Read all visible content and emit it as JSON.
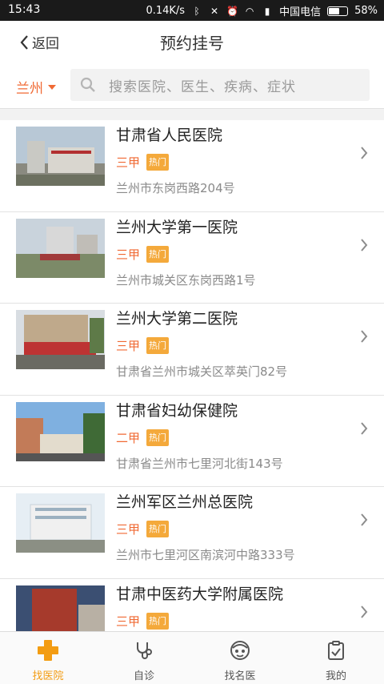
{
  "status": {
    "time": "15:43",
    "speed": "0.14K/s",
    "carrier": "中国电信",
    "battery": "58%",
    "battery_level": 0.58
  },
  "nav": {
    "back_label": "返回",
    "title": "预约挂号"
  },
  "search": {
    "city": "兰州",
    "placeholder": "搜索医院、医生、疾病、症状"
  },
  "hospitals": [
    {
      "name": "甘肃省人民医院",
      "level": "三甲",
      "badge": "热门",
      "address": "兰州市东岗西路204号"
    },
    {
      "name": "兰州大学第一医院",
      "level": "三甲",
      "badge": "热门",
      "address": "兰州市城关区东岗西路1号"
    },
    {
      "name": "兰州大学第二医院",
      "level": "三甲",
      "badge": "热门",
      "address": "甘肃省兰州市城关区萃英门82号"
    },
    {
      "name": "甘肃省妇幼保健院",
      "level": "二甲",
      "badge": "热门",
      "address": "甘肃省兰州市七里河北街143号"
    },
    {
      "name": "兰州军区兰州总医院",
      "level": "三甲",
      "badge": "热门",
      "address": "兰州市七里河区南滨河中路333号"
    },
    {
      "name": "甘肃中医药大学附属医院",
      "level": "三甲",
      "badge": "热门",
      "address": ""
    }
  ],
  "tabs": [
    {
      "label": "找医院",
      "icon": "cross-icon",
      "active": true
    },
    {
      "label": "自诊",
      "icon": "stethoscope-icon",
      "active": false
    },
    {
      "label": "找名医",
      "icon": "doctor-icon",
      "active": false
    },
    {
      "label": "我的",
      "icon": "clipboard-icon",
      "active": false
    }
  ],
  "colors": {
    "accent": "#f06a34",
    "badge": "#f4a93b",
    "tab_active": "#f39c12"
  }
}
